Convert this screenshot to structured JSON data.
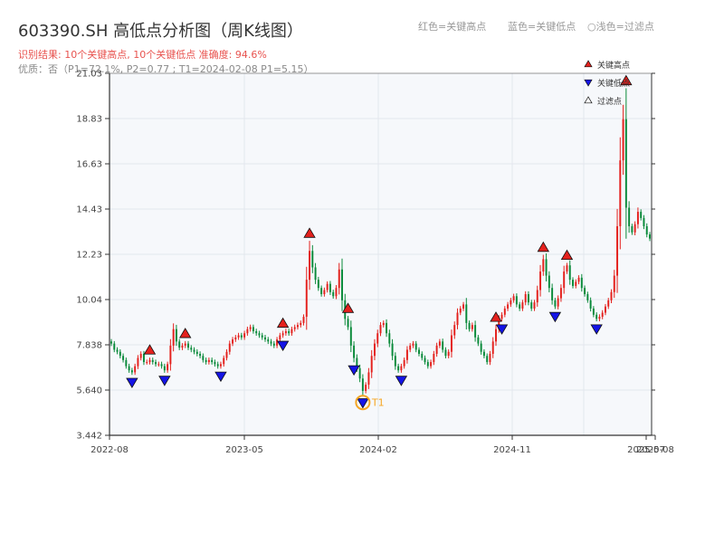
{
  "title": "603390.SH 高低点分析图（周K线图）",
  "subtitle_result": "识别结果: 10个关键高点, 10个关键低点   准确度: 94.6%",
  "subtitle_quality": "优质：否（P1=72.1%, P2=0.77 ; T1=2024-02-08 P1=5.15）",
  "top_legend": {
    "red": "红色=关键高点",
    "blue": "蓝色=关键低点",
    "light": "浅色=过滤点"
  },
  "colors": {
    "up": "#e4211d",
    "down": "#0a8a3a",
    "high_marker": "#e4211d",
    "low_marker": "#1414e6",
    "t1": "#f5a623",
    "plot_bg": "#f6f8fb",
    "grid": "#e3e7ee"
  },
  "chart_data": {
    "type": "candlestick",
    "title": "603390.SH 高低点分析图（周K线图）",
    "y_ticks": [
      "3.442",
      "5.640",
      "7.838",
      "10.04",
      "12.23",
      "14.43",
      "16.63",
      "18.83",
      "21.03"
    ],
    "ylim": [
      3.442,
      21.03
    ],
    "x_ticks": [
      "2022-08",
      "2023-05",
      "2024-02",
      "2024-11",
      "2025-07",
      "2025-08"
    ],
    "grid": true,
    "legend": {
      "position": "top-right",
      "items": [
        {
          "label": "关键高点",
          "marker": "high"
        },
        {
          "label": "关键低点",
          "marker": "low"
        },
        {
          "label": "过滤点",
          "marker": "filtered"
        }
      ]
    },
    "closes": [
      7.9,
      7.6,
      7.5,
      7.3,
      7.1,
      6.8,
      6.6,
      6.5,
      6.8,
      7.2,
      7.4,
      7.0,
      7.0,
      7.1,
      7.0,
      6.9,
      6.9,
      6.8,
      6.6,
      6.9,
      7.8,
      8.6,
      8.0,
      7.7,
      7.8,
      7.9,
      7.7,
      7.6,
      7.5,
      7.4,
      7.3,
      7.1,
      7.0,
      7.1,
      7.0,
      6.9,
      6.8,
      6.9,
      7.2,
      7.5,
      7.9,
      8.1,
      8.2,
      8.3,
      8.2,
      8.4,
      8.6,
      8.7,
      8.5,
      8.4,
      8.3,
      8.2,
      8.1,
      8.0,
      7.9,
      7.8,
      8.1,
      8.3,
      8.4,
      8.5,
      8.4,
      8.6,
      8.7,
      8.8,
      8.9,
      9.2,
      11.0,
      12.4,
      11.6,
      11.0,
      10.6,
      10.3,
      10.5,
      10.8,
      10.4,
      10.2,
      10.6,
      11.5,
      10.0,
      9.1,
      8.7,
      7.8,
      7.2,
      6.7,
      6.2,
      5.6,
      5.9,
      6.5,
      7.3,
      7.9,
      8.4,
      8.8,
      8.9,
      8.4,
      7.9,
      7.3,
      6.8,
      6.6,
      6.8,
      7.1,
      7.6,
      7.8,
      7.9,
      7.6,
      7.4,
      7.2,
      7.0,
      6.8,
      7.0,
      7.4,
      7.8,
      8.0,
      7.6,
      7.3,
      7.5,
      8.3,
      8.8,
      9.4,
      9.6,
      9.8,
      8.9,
      8.6,
      8.8,
      8.2,
      7.9,
      7.5,
      7.3,
      7.0,
      7.4,
      8.0,
      8.6,
      9.1,
      9.3,
      9.6,
      9.8,
      10.0,
      10.2,
      9.8,
      9.6,
      9.9,
      10.3,
      9.9,
      9.6,
      9.9,
      10.5,
      11.4,
      12.0,
      11.2,
      10.6,
      10.0,
      9.7,
      10.1,
      10.6,
      11.4,
      11.7,
      11.0,
      10.7,
      10.9,
      11.1,
      10.6,
      10.3,
      10.0,
      9.6,
      9.3,
      9.1,
      9.2,
      9.4,
      9.7,
      10.0,
      10.4,
      11.2,
      13.6,
      16.8,
      18.8,
      14.5,
      13.6,
      13.3,
      13.7,
      14.3,
      14.0,
      13.6,
      13.2,
      13.0
    ]
  },
  "markers": {
    "highs": [
      "",
      "",
      "",
      "",
      "",
      "",
      "",
      "",
      "",
      ""
    ],
    "lows": [
      "",
      "",
      "",
      "",
      "",
      "",
      "",
      "",
      "",
      ""
    ],
    "t1_label": "T1"
  }
}
